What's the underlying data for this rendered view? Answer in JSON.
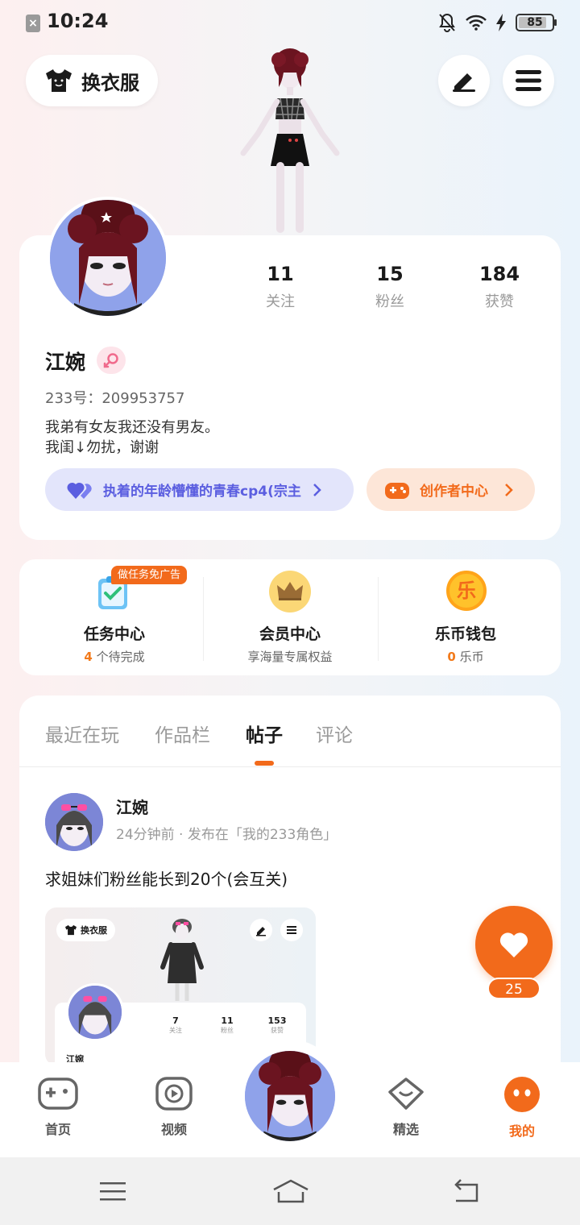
{
  "status_bar": {
    "time": "10:24",
    "battery": "85",
    "battery_level": 0.85
  },
  "header": {
    "outfit_label": "换衣服"
  },
  "profile": {
    "stats": [
      {
        "value": "11",
        "label": "关注"
      },
      {
        "value": "15",
        "label": "粉丝"
      },
      {
        "value": "184",
        "label": "获赞"
      }
    ],
    "name": "江婉",
    "uid": "233号：209953757",
    "bio_line1": "我弟有女友我还没有男友。",
    "bio_line2": "我闺↓勿扰，谢谢",
    "group_pill": "执着的年龄懵懂的青春cp4(宗主",
    "creator_pill": "创作者中心"
  },
  "services": {
    "task": {
      "badge": "做任务免广告",
      "title": "任务中心",
      "count": "4",
      "sub": "个待完成"
    },
    "member": {
      "title": "会员中心",
      "sub": "享海量专属权益"
    },
    "wallet": {
      "icon_glyph": "乐",
      "title": "乐币钱包",
      "count": "0",
      "sub": "乐币"
    }
  },
  "tabs": [
    "最近在玩",
    "作品栏",
    "帖子",
    "评论"
  ],
  "active_tab": "帖子",
  "post": {
    "author": "江婉",
    "meta": "24分钟前 · 发布在「我的233角色」",
    "text": "求姐妹们粉丝能长到20个(会互关)",
    "preview": {
      "outfit_label": "换衣服",
      "stats": [
        {
          "value": "7",
          "label": "关注"
        },
        {
          "value": "11",
          "label": "粉丝"
        },
        {
          "value": "153",
          "label": "获赞"
        }
      ],
      "name": "江婉"
    },
    "likes": "25"
  },
  "bottom_nav": [
    {
      "label": "首页",
      "icon": "gamepad-icon"
    },
    {
      "label": "视频",
      "icon": "play-icon"
    },
    {
      "label": "精选",
      "icon": "heart-badge-icon"
    },
    {
      "label": "我的",
      "icon": "face-icon"
    }
  ],
  "colors": {
    "accent": "#f26a1b",
    "purple": "#5b5ee0"
  }
}
